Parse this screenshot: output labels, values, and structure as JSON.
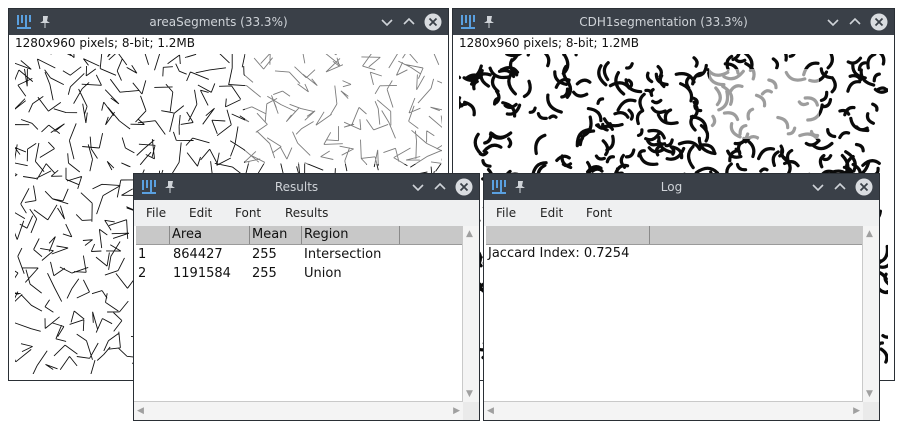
{
  "windows": {
    "area_segments": {
      "title": "areaSegments (33.3%)",
      "info": "1280x960 pixels; 8-bit; 1.2MB"
    },
    "cdh1": {
      "title": "CDH1segmentation (33.3%)",
      "info": "1280x960 pixels; 8-bit; 1.2MB"
    },
    "results": {
      "title": "Results",
      "menus": [
        "File",
        "Edit",
        "Font",
        "Results"
      ],
      "columns": [
        "",
        "Area",
        "Mean",
        "Region"
      ],
      "rows": [
        {
          "index": "1",
          "area": "864427",
          "mean": "255",
          "region": "Intersection"
        },
        {
          "index": "2",
          "area": "1191584",
          "mean": "255",
          "region": "Union"
        }
      ]
    },
    "log": {
      "title": "Log",
      "menus": [
        "File",
        "Edit",
        "Font"
      ],
      "lines": [
        "Jaccard Index: 0.7254"
      ]
    }
  },
  "colors": {
    "titlebar_bg": "#3a4048",
    "titlebar_text": "#cfd3d8",
    "menubar_bg": "#eff0f1",
    "table_header_bg": "#c8c8c8"
  },
  "icons": [
    "imagej-icon",
    "pin-icon",
    "minimize-icon",
    "maximize-icon",
    "close-icon",
    "scroll-up-icon",
    "scroll-down-icon",
    "scroll-left-icon",
    "scroll-right-icon"
  ]
}
